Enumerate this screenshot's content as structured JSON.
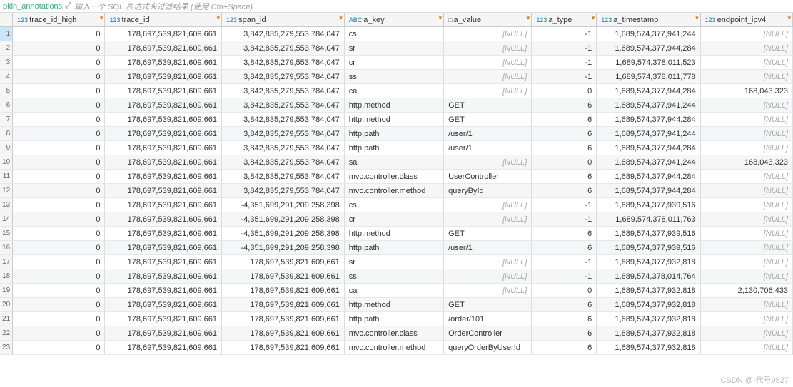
{
  "topbar": {
    "table_name": "pkin_annotations",
    "hint": "输入一个 SQL 表达式来过滤结果 (使用 Ctrl+Space)"
  },
  "columns": [
    {
      "key": "trace_id_high",
      "label": "trace_id_high",
      "type": "num",
      "icon": "123"
    },
    {
      "key": "trace_id",
      "label": "trace_id",
      "type": "num",
      "icon": "123"
    },
    {
      "key": "span_id",
      "label": "span_id",
      "type": "num",
      "icon": "123"
    },
    {
      "key": "a_key",
      "label": "a_key",
      "type": "str",
      "icon": "ABC"
    },
    {
      "key": "a_value",
      "label": "a_value",
      "type": "str",
      "icon": "□"
    },
    {
      "key": "a_type",
      "label": "a_type",
      "type": "num",
      "icon": "123"
    },
    {
      "key": "a_timestamp",
      "label": "a_timestamp",
      "type": "num",
      "icon": "123"
    },
    {
      "key": "endpoint_ipv4",
      "label": "endpoint_ipv4",
      "type": "num",
      "icon": "123"
    }
  ],
  "null_label": "[NULL]",
  "rows": [
    {
      "n": 1,
      "trace_id_high": "0",
      "trace_id": "178,697,539,821,609,661",
      "span_id": "3,842,835,279,553,784,047",
      "a_key": "cs",
      "a_value": null,
      "a_type": "-1",
      "a_timestamp": "1,689,574,377,941,244",
      "endpoint_ipv4": null
    },
    {
      "n": 2,
      "trace_id_high": "0",
      "trace_id": "178,697,539,821,609,661",
      "span_id": "3,842,835,279,553,784,047",
      "a_key": "sr",
      "a_value": null,
      "a_type": "-1",
      "a_timestamp": "1,689,574,377,944,284",
      "endpoint_ipv4": null
    },
    {
      "n": 3,
      "trace_id_high": "0",
      "trace_id": "178,697,539,821,609,661",
      "span_id": "3,842,835,279,553,784,047",
      "a_key": "cr",
      "a_value": null,
      "a_type": "-1",
      "a_timestamp": "1,689,574,378,011,523",
      "endpoint_ipv4": null
    },
    {
      "n": 4,
      "trace_id_high": "0",
      "trace_id": "178,697,539,821,609,661",
      "span_id": "3,842,835,279,553,784,047",
      "a_key": "ss",
      "a_value": null,
      "a_type": "-1",
      "a_timestamp": "1,689,574,378,011,778",
      "endpoint_ipv4": null
    },
    {
      "n": 5,
      "trace_id_high": "0",
      "trace_id": "178,697,539,821,609,661",
      "span_id": "3,842,835,279,553,784,047",
      "a_key": "ca",
      "a_value": null,
      "a_type": "0",
      "a_timestamp": "1,689,574,377,944,284",
      "endpoint_ipv4": "168,043,323"
    },
    {
      "n": 6,
      "trace_id_high": "0",
      "trace_id": "178,697,539,821,609,661",
      "span_id": "3,842,835,279,553,784,047",
      "a_key": "http.method",
      "a_value": "GET",
      "a_type": "6",
      "a_timestamp": "1,689,574,377,941,244",
      "endpoint_ipv4": null
    },
    {
      "n": 7,
      "trace_id_high": "0",
      "trace_id": "178,697,539,821,609,661",
      "span_id": "3,842,835,279,553,784,047",
      "a_key": "http.method",
      "a_value": "GET",
      "a_type": "6",
      "a_timestamp": "1,689,574,377,944,284",
      "endpoint_ipv4": null
    },
    {
      "n": 8,
      "trace_id_high": "0",
      "trace_id": "178,697,539,821,609,661",
      "span_id": "3,842,835,279,553,784,047",
      "a_key": "http.path",
      "a_value": "/user/1",
      "a_type": "6",
      "a_timestamp": "1,689,574,377,941,244",
      "endpoint_ipv4": null
    },
    {
      "n": 9,
      "trace_id_high": "0",
      "trace_id": "178,697,539,821,609,661",
      "span_id": "3,842,835,279,553,784,047",
      "a_key": "http.path",
      "a_value": "/user/1",
      "a_type": "6",
      "a_timestamp": "1,689,574,377,944,284",
      "endpoint_ipv4": null
    },
    {
      "n": 10,
      "trace_id_high": "0",
      "trace_id": "178,697,539,821,609,661",
      "span_id": "3,842,835,279,553,784,047",
      "a_key": "sa",
      "a_value": null,
      "a_type": "0",
      "a_timestamp": "1,689,574,377,941,244",
      "endpoint_ipv4": "168,043,323"
    },
    {
      "n": 11,
      "trace_id_high": "0",
      "trace_id": "178,697,539,821,609,661",
      "span_id": "3,842,835,279,553,784,047",
      "a_key": "mvc.controller.class",
      "a_value": "UserController",
      "a_type": "6",
      "a_timestamp": "1,689,574,377,944,284",
      "endpoint_ipv4": null
    },
    {
      "n": 12,
      "trace_id_high": "0",
      "trace_id": "178,697,539,821,609,661",
      "span_id": "3,842,835,279,553,784,047",
      "a_key": "mvc.controller.method",
      "a_value": "queryById",
      "a_type": "6",
      "a_timestamp": "1,689,574,377,944,284",
      "endpoint_ipv4": null
    },
    {
      "n": 13,
      "trace_id_high": "0",
      "trace_id": "178,697,539,821,609,661",
      "span_id": "-4,351,699,291,209,258,398",
      "a_key": "cs",
      "a_value": null,
      "a_type": "-1",
      "a_timestamp": "1,689,574,377,939,516",
      "endpoint_ipv4": null
    },
    {
      "n": 14,
      "trace_id_high": "0",
      "trace_id": "178,697,539,821,609,661",
      "span_id": "-4,351,699,291,209,258,398",
      "a_key": "cr",
      "a_value": null,
      "a_type": "-1",
      "a_timestamp": "1,689,574,378,011,763",
      "endpoint_ipv4": null
    },
    {
      "n": 15,
      "trace_id_high": "0",
      "trace_id": "178,697,539,821,609,661",
      "span_id": "-4,351,699,291,209,258,398",
      "a_key": "http.method",
      "a_value": "GET",
      "a_type": "6",
      "a_timestamp": "1,689,574,377,939,516",
      "endpoint_ipv4": null
    },
    {
      "n": 16,
      "trace_id_high": "0",
      "trace_id": "178,697,539,821,609,661",
      "span_id": "-4,351,699,291,209,258,398",
      "a_key": "http.path",
      "a_value": "/user/1",
      "a_type": "6",
      "a_timestamp": "1,689,574,377,939,516",
      "endpoint_ipv4": null
    },
    {
      "n": 17,
      "trace_id_high": "0",
      "trace_id": "178,697,539,821,609,661",
      "span_id": "178,697,539,821,609,661",
      "a_key": "sr",
      "a_value": null,
      "a_type": "-1",
      "a_timestamp": "1,689,574,377,932,818",
      "endpoint_ipv4": null
    },
    {
      "n": 18,
      "trace_id_high": "0",
      "trace_id": "178,697,539,821,609,661",
      "span_id": "178,697,539,821,609,661",
      "a_key": "ss",
      "a_value": null,
      "a_type": "-1",
      "a_timestamp": "1,689,574,378,014,764",
      "endpoint_ipv4": null
    },
    {
      "n": 19,
      "trace_id_high": "0",
      "trace_id": "178,697,539,821,609,661",
      "span_id": "178,697,539,821,609,661",
      "a_key": "ca",
      "a_value": null,
      "a_type": "0",
      "a_timestamp": "1,689,574,377,932,818",
      "endpoint_ipv4": "2,130,706,433"
    },
    {
      "n": 20,
      "trace_id_high": "0",
      "trace_id": "178,697,539,821,609,661",
      "span_id": "178,697,539,821,609,661",
      "a_key": "http.method",
      "a_value": "GET",
      "a_type": "6",
      "a_timestamp": "1,689,574,377,932,818",
      "endpoint_ipv4": null
    },
    {
      "n": 21,
      "trace_id_high": "0",
      "trace_id": "178,697,539,821,609,661",
      "span_id": "178,697,539,821,609,661",
      "a_key": "http.path",
      "a_value": "/order/101",
      "a_type": "6",
      "a_timestamp": "1,689,574,377,932,818",
      "endpoint_ipv4": null
    },
    {
      "n": 22,
      "trace_id_high": "0",
      "trace_id": "178,697,539,821,609,661",
      "span_id": "178,697,539,821,609,661",
      "a_key": "mvc.controller.class",
      "a_value": "OrderController",
      "a_type": "6",
      "a_timestamp": "1,689,574,377,932,818",
      "endpoint_ipv4": null
    },
    {
      "n": 23,
      "trace_id_high": "0",
      "trace_id": "178,697,539,821,609,661",
      "span_id": "178,697,539,821,609,661",
      "a_key": "mvc.controller.method",
      "a_value": "queryOrderByUserId",
      "a_type": "6",
      "a_timestamp": "1,689,574,377,932,818",
      "endpoint_ipv4": null
    }
  ],
  "watermark": "CSDN @-代号9527"
}
